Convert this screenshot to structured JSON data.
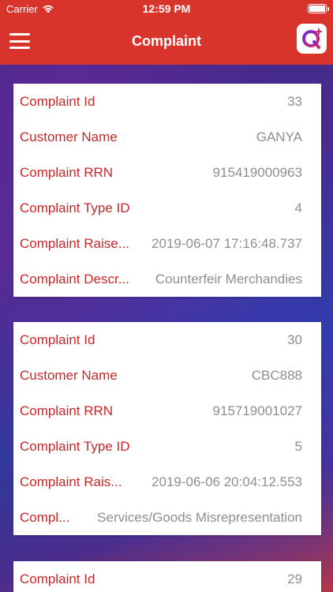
{
  "status_bar": {
    "carrier": "Carrier",
    "time": "12:59 PM"
  },
  "nav": {
    "title": "Complaint",
    "menu_icon": "hamburger-menu-icon",
    "logo_icon": "q-app-logo-icon"
  },
  "colors": {
    "primary": "#d9342b",
    "label": "#c62828",
    "value": "#8e8e93"
  },
  "complaints": [
    {
      "rows": [
        {
          "label": "Complaint Id",
          "value": "33"
        },
        {
          "label": "Customer Name",
          "value": "GANYA"
        },
        {
          "label": "Complaint RRN",
          "value": "915419000963"
        },
        {
          "label": "Complaint Type ID",
          "value": "4"
        },
        {
          "label": "Complaint Raise...",
          "value": "2019-06-07 17:16:48.737"
        },
        {
          "label": "Complaint Descr...",
          "value": "Counterfeir Merchandies"
        }
      ]
    },
    {
      "rows": [
        {
          "label": "Complaint Id",
          "value": "30"
        },
        {
          "label": "Customer Name",
          "value": "CBC888"
        },
        {
          "label": "Complaint RRN",
          "value": "915719001027"
        },
        {
          "label": "Complaint Type ID",
          "value": "5"
        },
        {
          "label": "Complaint Rais...",
          "value": "2019-06-06 20:04:12.553"
        },
        {
          "label": "Compl...",
          "value": "Services/Goods Misrepresentation"
        }
      ]
    },
    {
      "rows": [
        {
          "label": "Complaint Id",
          "value": "29"
        }
      ]
    }
  ]
}
